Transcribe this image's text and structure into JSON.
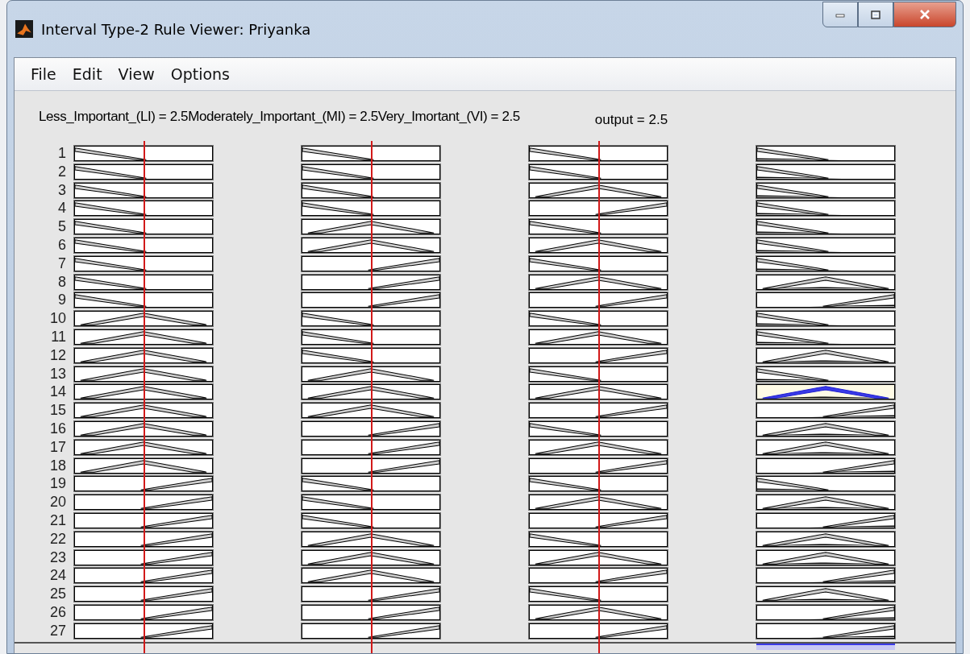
{
  "window": {
    "title": "Interval Type-2 Rule Viewer: Priyanka"
  },
  "menu": [
    "File",
    "Edit",
    "View",
    "Options"
  ],
  "input_header": "Less_Important_(LI) = 2.5Moderately_Important_(MI) = 2.5Very_Imortant_(VI) = 2.5",
  "output_header": "output = 2.5",
  "inputs": [
    {
      "level": 0.5
    },
    {
      "level": 0.5
    },
    {
      "level": 0.5
    }
  ],
  "rules": [
    {
      "number": "1",
      "plots": [
        {
          "kind": "low"
        },
        {
          "kind": "low"
        },
        {
          "kind": "low"
        },
        {
          "kind": "low"
        }
      ],
      "fired": false
    },
    {
      "number": "2",
      "plots": [
        {
          "kind": "low"
        },
        {
          "kind": "low"
        },
        {
          "kind": "low"
        },
        {
          "kind": "low"
        }
      ],
      "fired": false
    },
    {
      "number": "3",
      "plots": [
        {
          "kind": "low"
        },
        {
          "kind": "low"
        },
        {
          "kind": "mid"
        },
        {
          "kind": "low"
        }
      ],
      "fired": false
    },
    {
      "number": "4",
      "plots": [
        {
          "kind": "low"
        },
        {
          "kind": "low"
        },
        {
          "kind": "high"
        },
        {
          "kind": "low"
        }
      ],
      "fired": false
    },
    {
      "number": "5",
      "plots": [
        {
          "kind": "low"
        },
        {
          "kind": "mid"
        },
        {
          "kind": "low"
        },
        {
          "kind": "low"
        }
      ],
      "fired": false
    },
    {
      "number": "6",
      "plots": [
        {
          "kind": "low"
        },
        {
          "kind": "mid"
        },
        {
          "kind": "mid"
        },
        {
          "kind": "low"
        }
      ],
      "fired": false
    },
    {
      "number": "7",
      "plots": [
        {
          "kind": "low"
        },
        {
          "kind": "high"
        },
        {
          "kind": "low"
        },
        {
          "kind": "low"
        }
      ],
      "fired": false
    },
    {
      "number": "8",
      "plots": [
        {
          "kind": "low"
        },
        {
          "kind": "high"
        },
        {
          "kind": "mid"
        },
        {
          "kind": "mid"
        }
      ],
      "fired": false
    },
    {
      "number": "9",
      "plots": [
        {
          "kind": "low"
        },
        {
          "kind": "high"
        },
        {
          "kind": "high"
        },
        {
          "kind": "high"
        }
      ],
      "fired": false
    },
    {
      "number": "10",
      "plots": [
        {
          "kind": "mid"
        },
        {
          "kind": "low"
        },
        {
          "kind": "low"
        },
        {
          "kind": "low"
        }
      ],
      "fired": false
    },
    {
      "number": "11",
      "plots": [
        {
          "kind": "mid"
        },
        {
          "kind": "low"
        },
        {
          "kind": "mid"
        },
        {
          "kind": "low"
        }
      ],
      "fired": false
    },
    {
      "number": "12",
      "plots": [
        {
          "kind": "mid"
        },
        {
          "kind": "low"
        },
        {
          "kind": "high"
        },
        {
          "kind": "mid"
        }
      ],
      "fired": false
    },
    {
      "number": "13",
      "plots": [
        {
          "kind": "mid"
        },
        {
          "kind": "mid"
        },
        {
          "kind": "low"
        },
        {
          "kind": "low"
        }
      ],
      "fired": false
    },
    {
      "number": "14",
      "plots": [
        {
          "kind": "mid"
        },
        {
          "kind": "mid"
        },
        {
          "kind": "mid"
        },
        {
          "kind": "mid"
        }
      ],
      "fired": true
    },
    {
      "number": "15",
      "plots": [
        {
          "kind": "mid"
        },
        {
          "kind": "mid"
        },
        {
          "kind": "high"
        },
        {
          "kind": "high"
        }
      ],
      "fired": false
    },
    {
      "number": "16",
      "plots": [
        {
          "kind": "mid"
        },
        {
          "kind": "high"
        },
        {
          "kind": "low"
        },
        {
          "kind": "mid"
        }
      ],
      "fired": false
    },
    {
      "number": "17",
      "plots": [
        {
          "kind": "mid"
        },
        {
          "kind": "high"
        },
        {
          "kind": "mid"
        },
        {
          "kind": "mid"
        }
      ],
      "fired": false
    },
    {
      "number": "18",
      "plots": [
        {
          "kind": "mid"
        },
        {
          "kind": "high"
        },
        {
          "kind": "high"
        },
        {
          "kind": "high"
        }
      ],
      "fired": false
    },
    {
      "number": "19",
      "plots": [
        {
          "kind": "high"
        },
        {
          "kind": "low"
        },
        {
          "kind": "low"
        },
        {
          "kind": "low"
        }
      ],
      "fired": false
    },
    {
      "number": "20",
      "plots": [
        {
          "kind": "high"
        },
        {
          "kind": "low"
        },
        {
          "kind": "mid"
        },
        {
          "kind": "mid"
        }
      ],
      "fired": false
    },
    {
      "number": "21",
      "plots": [
        {
          "kind": "high"
        },
        {
          "kind": "low"
        },
        {
          "kind": "high"
        },
        {
          "kind": "high"
        }
      ],
      "fired": false
    },
    {
      "number": "22",
      "plots": [
        {
          "kind": "high"
        },
        {
          "kind": "mid"
        },
        {
          "kind": "low"
        },
        {
          "kind": "mid"
        }
      ],
      "fired": false
    },
    {
      "number": "23",
      "plots": [
        {
          "kind": "high"
        },
        {
          "kind": "mid"
        },
        {
          "kind": "mid"
        },
        {
          "kind": "mid"
        }
      ],
      "fired": false
    },
    {
      "number": "24",
      "plots": [
        {
          "kind": "high"
        },
        {
          "kind": "mid"
        },
        {
          "kind": "high"
        },
        {
          "kind": "high"
        }
      ],
      "fired": false
    },
    {
      "number": "25",
      "plots": [
        {
          "kind": "high"
        },
        {
          "kind": "high"
        },
        {
          "kind": "low"
        },
        {
          "kind": "mid"
        }
      ],
      "fired": false
    },
    {
      "number": "26",
      "plots": [
        {
          "kind": "high"
        },
        {
          "kind": "high"
        },
        {
          "kind": "mid"
        },
        {
          "kind": "high"
        }
      ],
      "fired": false
    },
    {
      "number": "27",
      "plots": [
        {
          "kind": "high"
        },
        {
          "kind": "high"
        },
        {
          "kind": "high"
        },
        {
          "kind": "high"
        }
      ],
      "fired": false
    }
  ]
}
